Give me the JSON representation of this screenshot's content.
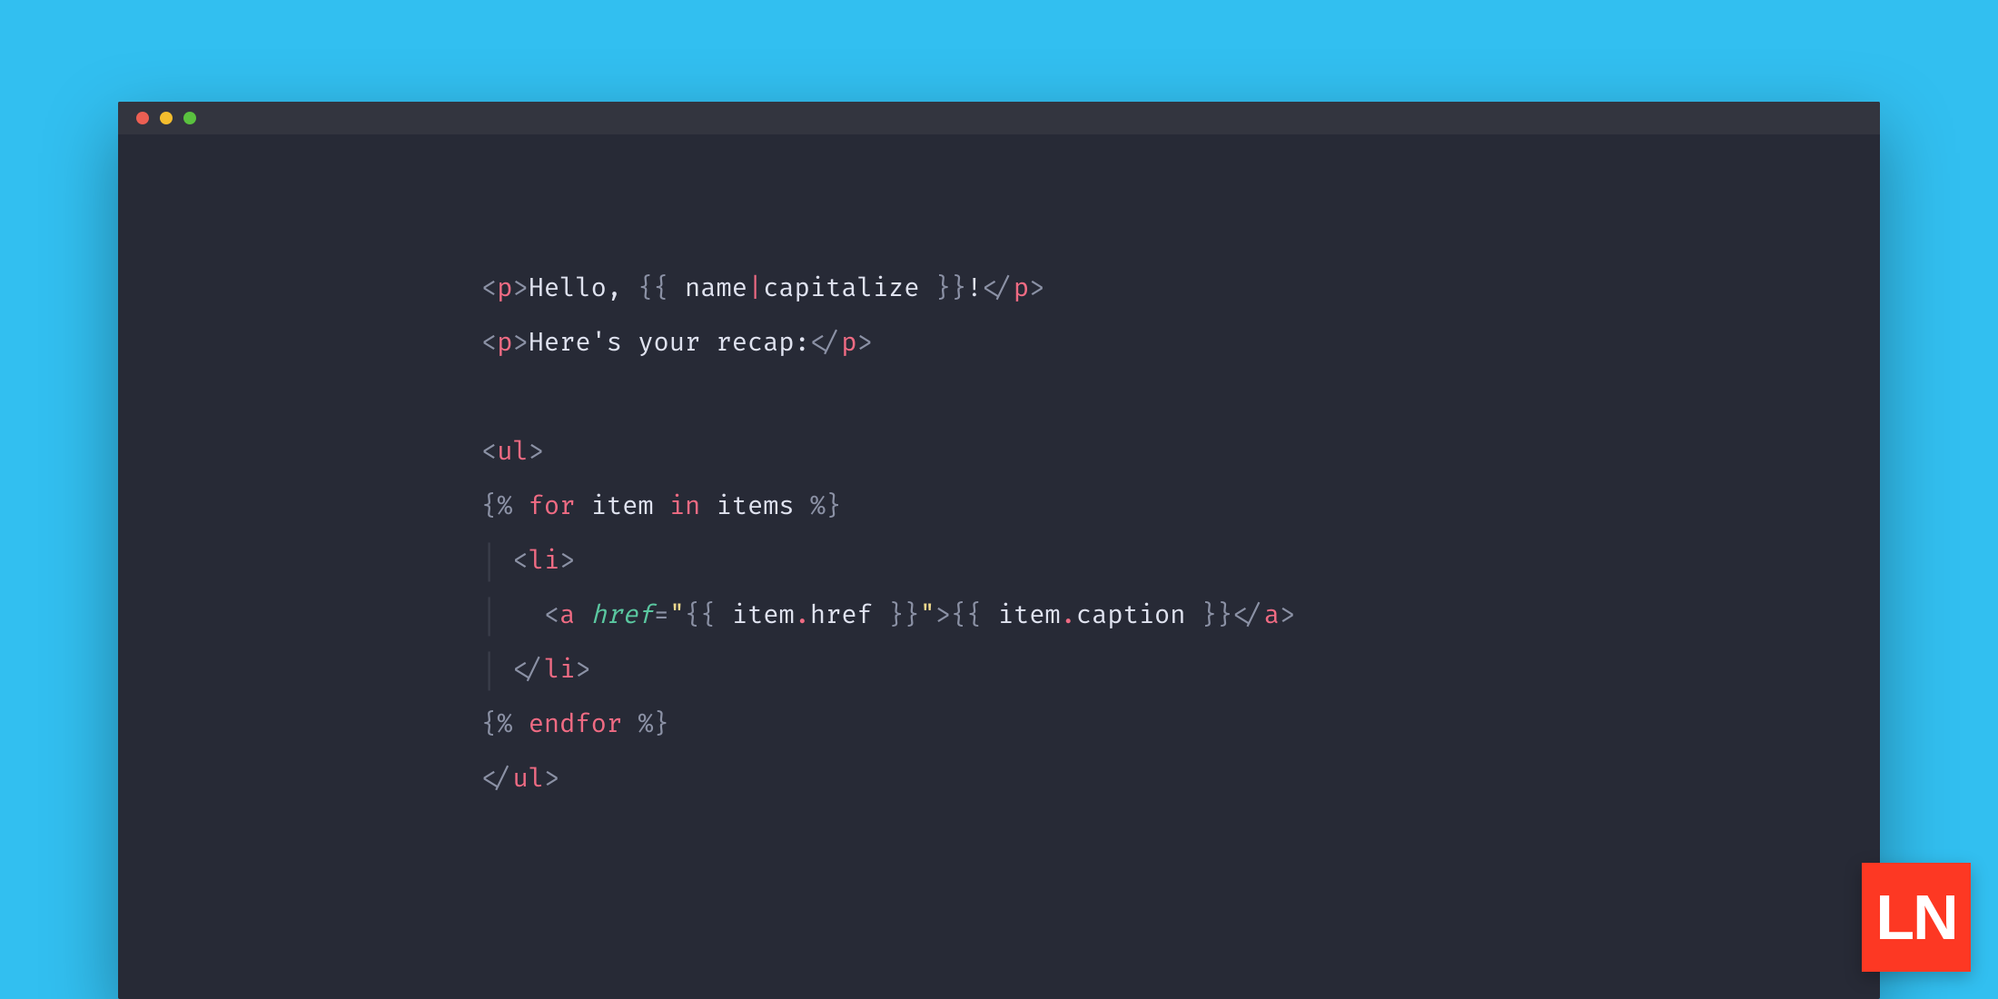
{
  "colors": {
    "page_bg": "#32bff0",
    "window_bg": "#272a36",
    "titlebar_bg": "#33353f",
    "traffic_red": "#ec5f53",
    "traffic_yellow": "#f4bd2e",
    "traffic_green": "#5ac13f",
    "punct": "#8b91a5",
    "tag": "#ef6b83",
    "attr": "#5ac7a0",
    "string": "#ecd78c",
    "text": "#dfe2ef",
    "logo_bg": "#fd3823",
    "logo_fg": "#ffffff"
  },
  "logo_text": "LN",
  "code": {
    "l1": {
      "open_lt": "<",
      "tag_p": "p",
      "open_gt": ">",
      "hello": "Hello, ",
      "dl_open": "{{ ",
      "var_name": "name",
      "pipe": "|",
      "filter": "capitalize",
      "dl_close": " }}",
      "bang": "!",
      "close_lt": "</",
      "close_gt": ">"
    },
    "l2": {
      "open_lt": "<",
      "tag_p": "p",
      "open_gt": ">",
      "text": "Here's your recap:",
      "close_lt": "</",
      "close_gt": ">"
    },
    "l3_blank": "",
    "l4": {
      "open_lt": "<",
      "tag_ul": "ul",
      "open_gt": ">"
    },
    "l5": {
      "stmt_open": "{% ",
      "kw_for": "for",
      "sp1": " ",
      "var_item": "item",
      "sp2": " ",
      "kw_in": "in",
      "sp3": " ",
      "var_items": "items",
      "stmt_close": " %}"
    },
    "l6": {
      "indent": "  ",
      "open_lt": "<",
      "tag_li": "li",
      "open_gt": ">"
    },
    "l7": {
      "indent": "    ",
      "open_lt": "<",
      "tag_a": "a",
      "sp": " ",
      "attr_href": "href",
      "eq": "=",
      "q1": "\"",
      "dl_open1": "{{ ",
      "obj1": "item",
      "dot1": ".",
      "prop1": "href",
      "dl_close1": " }}",
      "q2": "\"",
      "open_gt": ">",
      "dl_open2": "{{ ",
      "obj2": "item",
      "dot2": ".",
      "prop2": "caption",
      "dl_close2": " }}",
      "close_lt": "</",
      "close_gt": ">"
    },
    "l8": {
      "indent": "  ",
      "close_lt": "</",
      "tag_li": "li",
      "close_gt": ">"
    },
    "l9": {
      "stmt_open": "{% ",
      "kw_endfor": "endfor",
      "stmt_close": " %}"
    },
    "l10": {
      "close_lt": "</",
      "tag_ul": "ul",
      "close_gt": ">"
    }
  }
}
